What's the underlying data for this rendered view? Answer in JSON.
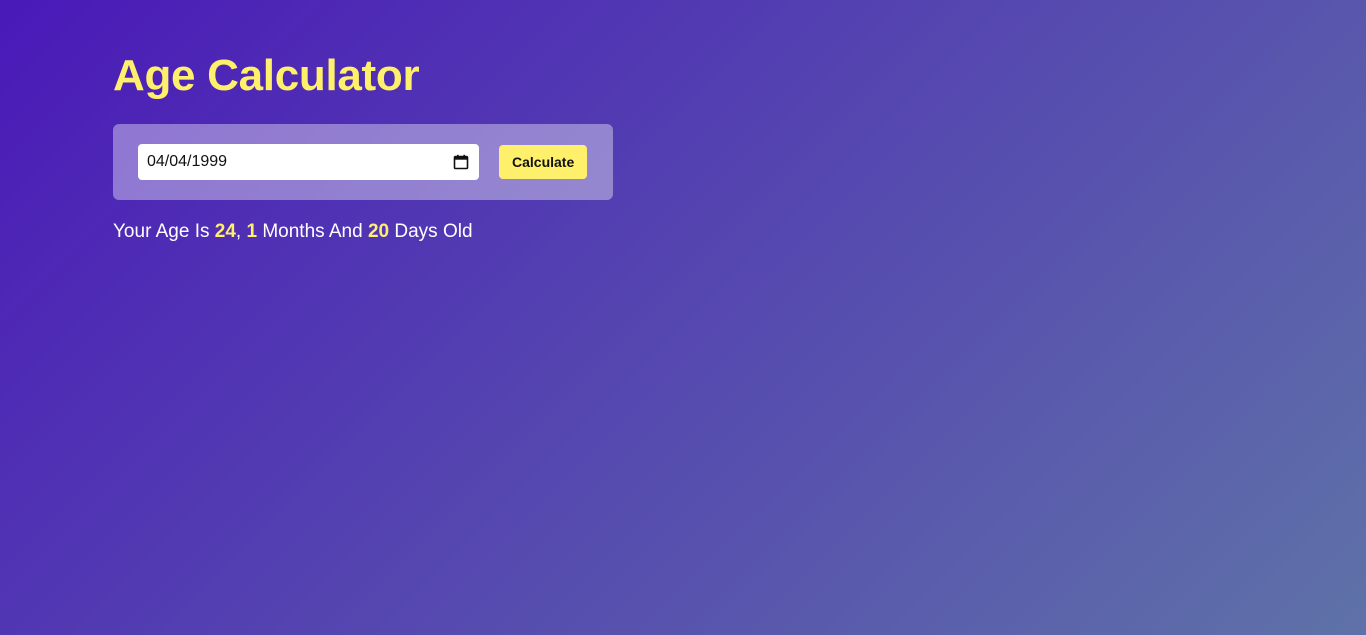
{
  "title": "Age Calculator",
  "date_input": {
    "value": "04/04/1999",
    "icon": "calendar-icon"
  },
  "calculate_button": {
    "label": "Calculate"
  },
  "result": {
    "prefix": "Your Age Is ",
    "years": "24",
    "sep1": ", ",
    "months": "1",
    "mid": " Months And ",
    "days": "20",
    "suffix": " Days Old"
  },
  "colors": {
    "accent": "#fff06b",
    "bg_start": "#4a19b8",
    "bg_end": "#5f72a8"
  }
}
